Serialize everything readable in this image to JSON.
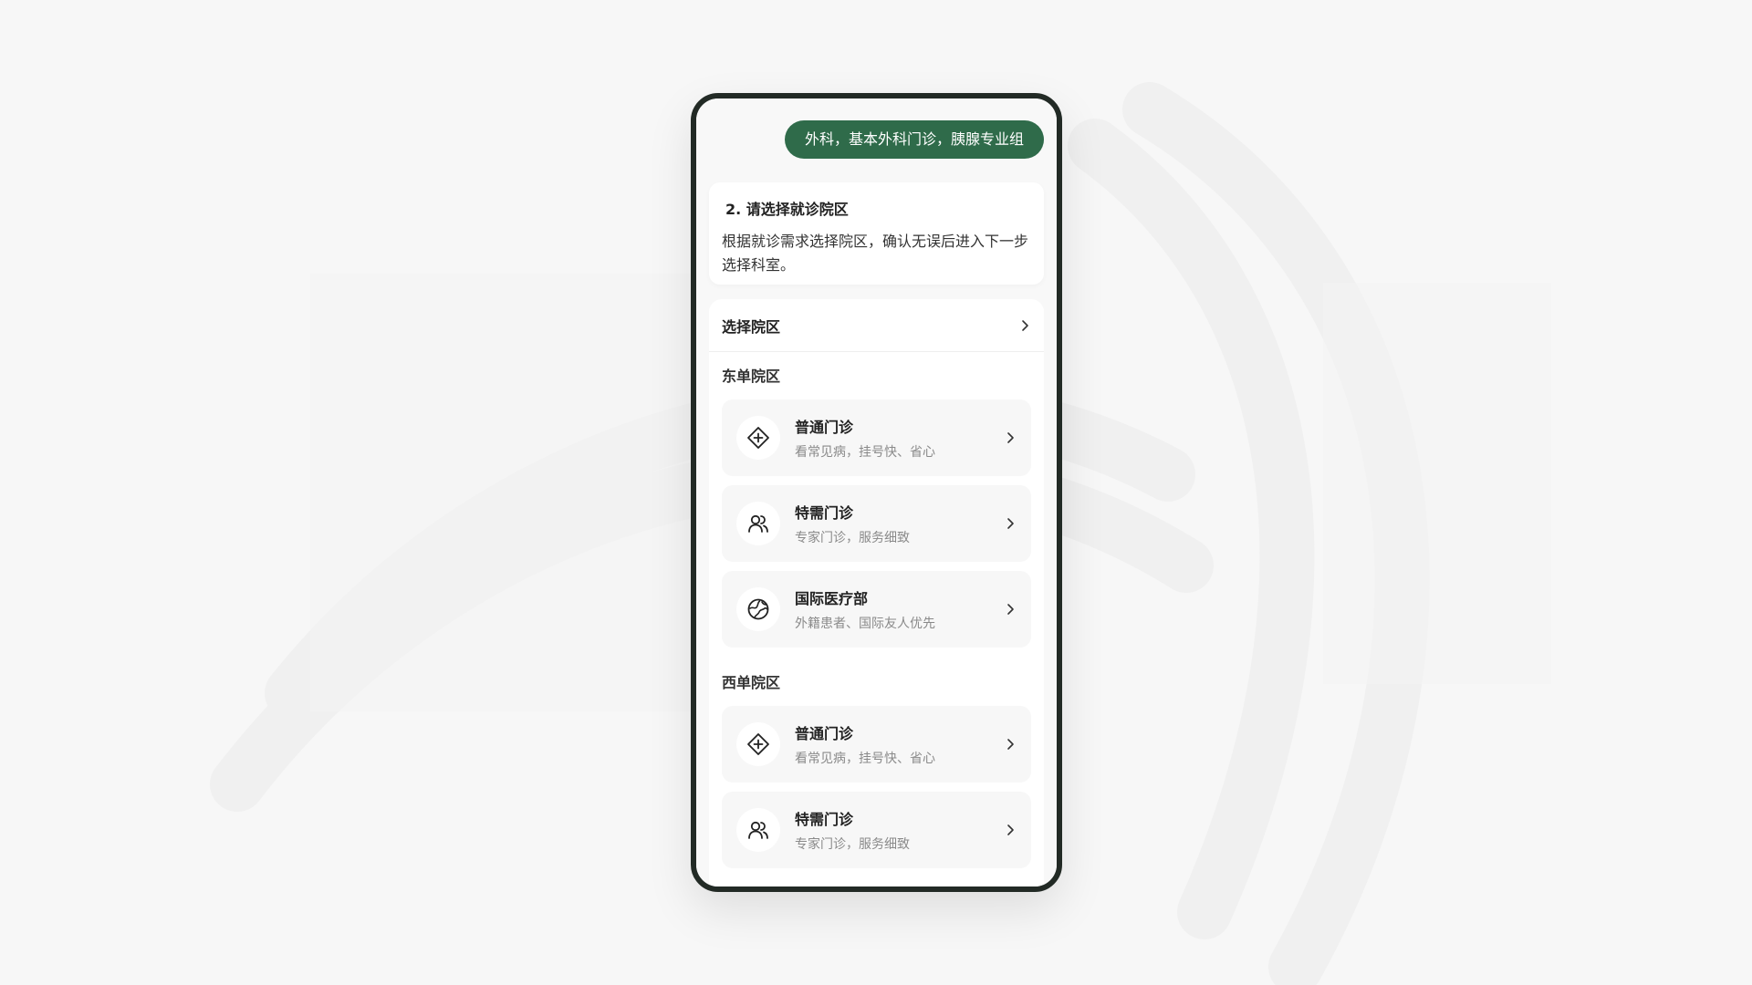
{
  "chat": {
    "bubble_text": "外科，基本外科门诊，胰腺专业组"
  },
  "step": {
    "title": "2. 请选择就诊院区",
    "description": "根据就诊需求选择院区，确认无误后进入下一步选择科室。"
  },
  "campus_selector": {
    "label": "选择院区"
  },
  "groups": [
    {
      "title": "东单院区",
      "items": [
        {
          "title": "普通门诊",
          "subtitle": "看常见病，挂号快、省心",
          "icon": "medical-diamond-icon"
        },
        {
          "title": "特需门诊",
          "subtitle": "专家门诊，服务细致",
          "icon": "users-icon"
        },
        {
          "title": "国际医疗部",
          "subtitle": "外籍患者、国际友人优先",
          "icon": "globe-icon"
        }
      ]
    },
    {
      "title": "西单院区",
      "items": [
        {
          "title": "普通门诊",
          "subtitle": "看常见病，挂号快、省心",
          "icon": "medical-diamond-icon"
        },
        {
          "title": "特需门诊",
          "subtitle": "专家门诊，服务细致",
          "icon": "users-icon"
        }
      ]
    }
  ],
  "colors": {
    "accent": "#2f6b4a",
    "frame": "#222a25",
    "background": "#f7f7f7"
  }
}
